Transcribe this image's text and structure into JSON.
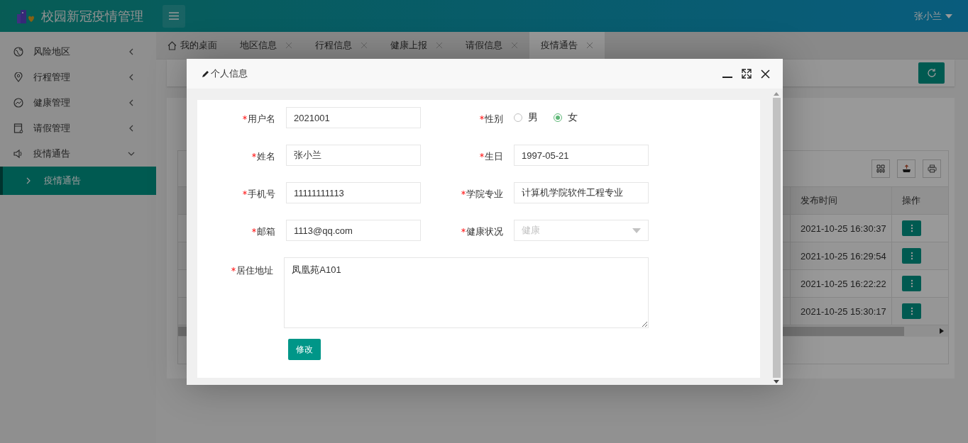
{
  "header": {
    "title": "校园新冠疫情管理",
    "user": "张小兰"
  },
  "sidebar": {
    "items": [
      {
        "label": "风险地区",
        "expanded": false
      },
      {
        "label": "行程管理",
        "expanded": false
      },
      {
        "label": "健康管理",
        "expanded": false
      },
      {
        "label": "请假管理",
        "expanded": false
      },
      {
        "label": "疫情通告",
        "expanded": true,
        "children": [
          {
            "label": "疫情通告",
            "selected": true
          }
        ]
      }
    ]
  },
  "tabs": [
    {
      "label": "我的桌面",
      "kind": "home",
      "selected": false
    },
    {
      "label": "地区信息",
      "kind": "page",
      "selected": false
    },
    {
      "label": "行程信息",
      "kind": "page",
      "selected": false
    },
    {
      "label": "健康上报",
      "kind": "page",
      "selected": false
    },
    {
      "label": "请假信息",
      "kind": "page",
      "selected": false
    },
    {
      "label": "疫情通告",
      "kind": "page",
      "selected": true
    }
  ],
  "table": {
    "columns": [
      "发布时间",
      "操作"
    ],
    "rows": [
      {
        "time": "2021-10-25 16:30:37"
      },
      {
        "time": "2021-10-25 16:29:54"
      },
      {
        "time": "2021-10-25 16:22:22"
      },
      {
        "time": "2021-10-25 15:30:17"
      }
    ]
  },
  "dialog": {
    "title": "个人信息",
    "fields": [
      {
        "label": "用户名",
        "kind": "text",
        "required": true,
        "value": "2021001"
      },
      {
        "label": "性别",
        "kind": "radio",
        "required": true,
        "options": [
          {
            "label": "男",
            "selected": false
          },
          {
            "label": "女",
            "selected": true
          }
        ]
      },
      {
        "label": "姓名",
        "kind": "text",
        "required": true,
        "value": "张小兰"
      },
      {
        "label": "生日",
        "kind": "text",
        "required": true,
        "value": "1997-05-21"
      },
      {
        "label": "手机号",
        "kind": "text",
        "required": true,
        "value": "11111111113"
      },
      {
        "label": "学院专业",
        "kind": "text",
        "required": true,
        "value": "计算机学院软件工程专业"
      },
      {
        "label": "邮箱",
        "kind": "text",
        "required": true,
        "value": "1113@qq.com"
      },
      {
        "label": "健康状况",
        "kind": "select",
        "required": true,
        "disabled": true,
        "placeholder": "健康"
      },
      {
        "label": "居住地址",
        "kind": "textarea",
        "required": true,
        "value": "凤凰苑A101"
      }
    ],
    "button": "修改"
  }
}
